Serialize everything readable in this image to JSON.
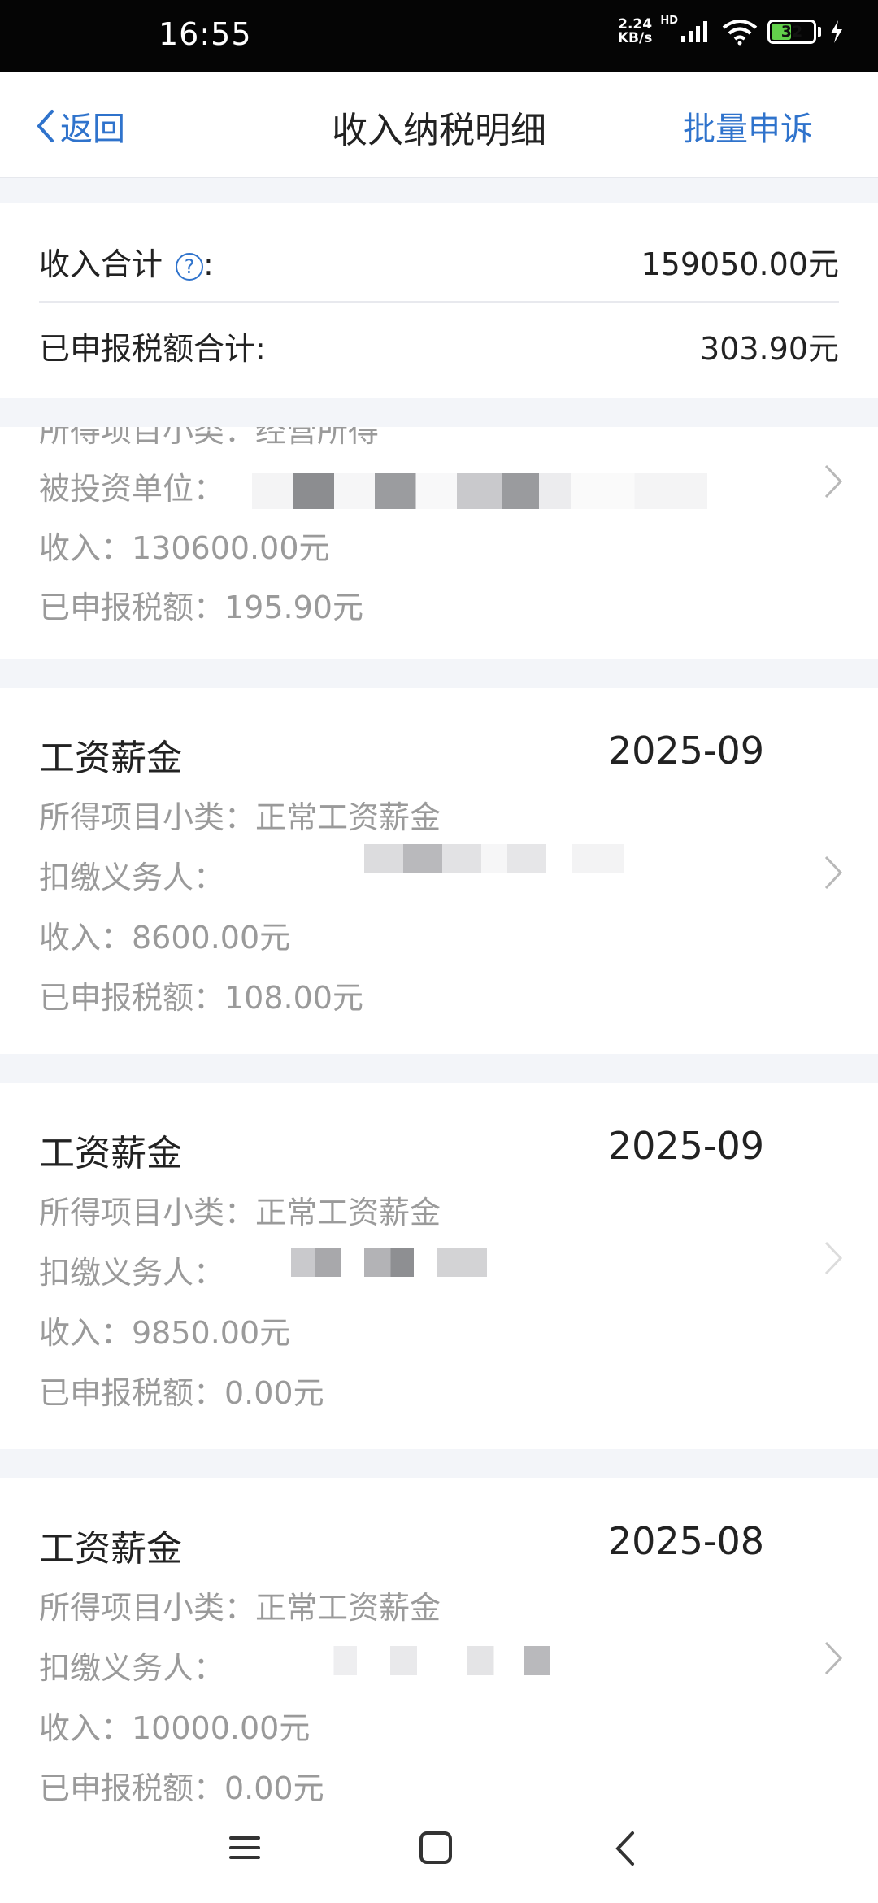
{
  "status_bar": {
    "time": "16:55",
    "net_speed_value": "2.24",
    "net_speed_unit": "KB/s",
    "hd_label": "HD",
    "battery": "32"
  },
  "nav": {
    "back_label": "返回",
    "title": "收入纳税明细",
    "action_label": "批量申诉"
  },
  "summary": {
    "income_label": "收入合计",
    "help_icon": "?",
    "colon": ":",
    "income_value": "159050.00元",
    "tax_label": "已申报税额合计:",
    "tax_value": "303.90元"
  },
  "records": [
    {
      "category_line": "所得项目小类：经营所得",
      "payer_label": "被投资单位：",
      "income_line": "收入：130600.00元",
      "tax_line": "已申报税额：195.90元"
    },
    {
      "title": "工资薪金",
      "date": "2025-09",
      "category_line": "所得项目小类：正常工资薪金",
      "payer_label": "扣缴义务人：",
      "income_line": "收入：8600.00元",
      "tax_line": "已申报税额：108.00元"
    },
    {
      "title": "工资薪金",
      "date": "2025-09",
      "category_line": "所得项目小类：正常工资薪金",
      "payer_label": "扣缴义务人：",
      "income_line": "收入：9850.00元",
      "tax_line": "已申报税额：0.00元"
    },
    {
      "title": "工资薪金",
      "date": "2025-08",
      "category_line": "所得项目小类：正常工资薪金",
      "payer_label": "扣缴义务人：",
      "income_line": "收入：10000.00元",
      "tax_line": "已申报税额：0.00元"
    }
  ],
  "colors": {
    "accent": "#2f73cc",
    "muted_text": "#9a9a9a",
    "background": "#f3f5f9"
  },
  "icons": {
    "back": "chevron-left-icon",
    "help": "question-circle-icon",
    "row_arrow": "chevron-right-icon",
    "nav_menu": "menu-icon",
    "nav_home": "home-square-icon",
    "nav_back": "back-triangle-icon"
  }
}
